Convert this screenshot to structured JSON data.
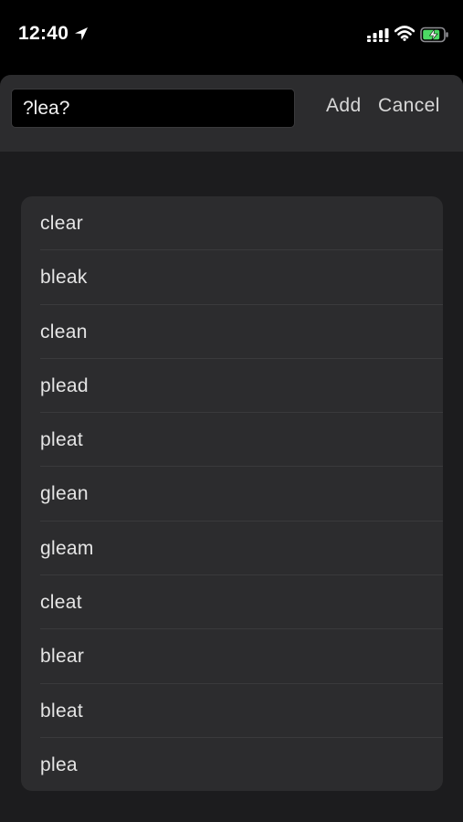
{
  "status_bar": {
    "time": "12:40",
    "icons": [
      "location-arrow-icon",
      "signal-icon",
      "wifi-icon",
      "battery-charging-icon"
    ]
  },
  "search": {
    "value": "?lea?",
    "add_label": "Add",
    "cancel_label": "Cancel"
  },
  "results": [
    "clear",
    "bleak",
    "clean",
    "plead",
    "pleat",
    "glean",
    "gleam",
    "cleat",
    "blear",
    "bleat",
    "plea"
  ],
  "colors": {
    "background": "#000000",
    "sheet": "#1c1c1e",
    "panel": "#2c2c2e",
    "separator": "#3a3a3c",
    "battery_green": "#4cd964"
  }
}
